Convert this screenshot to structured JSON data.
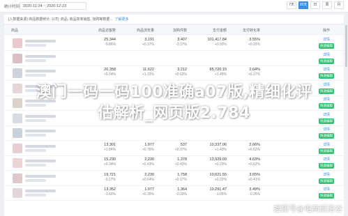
{
  "topbar": {
    "stat_label": "统计时间",
    "date_range": "2020-11-24 ~ 2020-12-23",
    "range_buttons": [
      {
        "label": "7天",
        "active": false
      },
      {
        "label": "30天",
        "active": true
      },
      {
        "label": "日",
        "active": false
      },
      {
        "label": "周",
        "active": false
      },
      {
        "label": "月",
        "active": false
      }
    ]
  },
  "info_bar": {
    "text": "[入数据来源] 商品数据统计, 公司, 商品, 商品效率销售, 加购等数据...",
    "link": "了解更多"
  },
  "table": {
    "headers": {
      "name": "商品",
      "c1": "商品访客数",
      "c2": "商品浏览量",
      "c3": "加购件数",
      "c4": "支付金额",
      "c5": "支付转化率",
      "op": "操作"
    },
    "rows": [
      {
        "thumb": "#e9c9cf",
        "c1": [
          "25,344",
          "-0.86%"
        ],
        "c2": [
          "3,191",
          "+0.37%"
        ],
        "c3": [
          "3,407",
          "-0.37%"
        ],
        "c4": [
          "101,417.84",
          "+0.93%"
        ],
        "c5": [
          "3.55%",
          "+0.15%"
        ]
      },
      {
        "thumb": "#d9c0c4",
        "c1": [
          "",
          ""
        ],
        "c2": [
          "",
          ""
        ],
        "c3": [
          "",
          ""
        ],
        "c4": [
          "",
          ""
        ],
        "c5": [
          "",
          ""
        ]
      },
      {
        "thumb": "#cfd4dc",
        "c1": [
          "20,358",
          "+0.54%"
        ],
        "c2": [
          "11,622",
          "+1.72%"
        ],
        "c3": [
          "3,212",
          "+0.62%"
        ],
        "c4": [
          "85,720.15",
          "+1.45%"
        ],
        "c5": [
          "2.64%",
          "+0.27%"
        ]
      },
      {
        "thumb": "#e4d7d9",
        "c1": [
          "",
          ""
        ],
        "c2": [
          "",
          ""
        ],
        "c3": [
          "",
          ""
        ],
        "c4": [
          "",
          ""
        ],
        "c5": [
          "",
          ""
        ]
      },
      {
        "thumb": "#dcd2cc",
        "c1": [
          "",
          ""
        ],
        "c2": [
          "",
          ""
        ],
        "c3": [
          "",
          ""
        ],
        "c4": [
          "",
          ""
        ],
        "c5": [
          "",
          ""
        ]
      },
      {
        "thumb": "#d8dbe0",
        "c1": [
          "",
          ""
        ],
        "c2": [
          "",
          ""
        ],
        "c3": [
          "",
          ""
        ],
        "c4": [
          "",
          ""
        ],
        "c5": [
          "",
          ""
        ]
      },
      {
        "thumb": "#c9d2d9",
        "c1": [
          "",
          ""
        ],
        "c2": [
          "",
          ""
        ],
        "c3": [
          "",
          ""
        ],
        "c4": [
          "",
          ""
        ],
        "c5": [
          "",
          ""
        ]
      },
      {
        "thumb": "#e6cfd3",
        "c1": [
          "13,301",
          "+1.84%"
        ],
        "c2": [
          "1,977",
          "+0.76%"
        ],
        "c3": [
          "537",
          "+0.37%"
        ],
        "c4": [
          "10,337.06",
          "+1.43%"
        ],
        "c5": [
          "2.66%",
          "+0.62%"
        ]
      },
      {
        "thumb": "#e9d4d6",
        "c1": [
          "15,230",
          "+0.34%"
        ],
        "c2": [
          "2,230",
          "+0.43%"
        ],
        "c3": [
          "1,378",
          "+0.43%"
        ],
        "c4": [
          "13,929.09",
          "+0.23%"
        ],
        "c5": [
          "4.63%",
          "+0.62%"
        ]
      },
      {
        "thumb": "#dfc8cd",
        "c1": [
          "19,721",
          "-0.27%"
        ],
        "c2": [
          "2,230",
          "+0.64%"
        ],
        "c3": [
          "1,758",
          "+0.17%"
        ],
        "c4": [
          "10,021.55",
          "+0.22%"
        ],
        "c5": [
          "3.65%",
          "+0.41%"
        ]
      },
      {
        "thumb": "#e3d6da",
        "c1": [
          "13,352",
          "-1.60%"
        ],
        "c2": [
          "1,977",
          "+0.35%"
        ],
        "c3": [
          "1,364",
          "-0.33%"
        ],
        "c4": [
          "10,291.47",
          "-1.05%"
        ],
        "c5": [
          "3.49%",
          "-0.26%"
        ]
      }
    ],
    "op_link": "详情",
    "op_btn": "快速编辑"
  },
  "headline": {
    "line1": "澳门一码一码100准确a07版,精细化评",
    "line2": "估解析_网页版2.784"
  },
  "watermark": "搜狐号@电商前沿谷"
}
